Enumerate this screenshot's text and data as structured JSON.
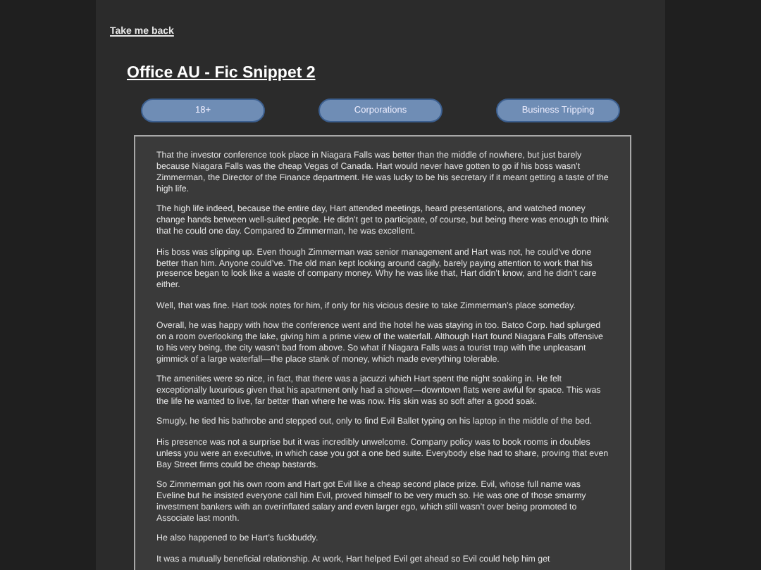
{
  "back_link": "Take me back",
  "title": "Office AU - Fic Snippet 2",
  "tags": [
    "18+",
    "Corporations",
    "Business Tripping"
  ],
  "paragraphs": [
    "That the investor conference took place in Niagara Falls was better than the middle of nowhere, but just barely because Niagara Falls was the cheap Vegas of Canada. Hart would never have gotten to go if his boss wasn’t Zimmerman, the Director of the Finance department. He was lucky to be his secretary if it meant getting a taste of the high life.",
    "The high life indeed, because the entire day, Hart attended meetings, heard presentations, and watched money change hands between well-suited people. He didn’t get to participate, of course, but being there was enough to think that he could one day. Compared to Zimmerman, he was excellent.",
    "His boss was slipping up. Even though Zimmerman was senior management and Hart was not, he could’ve done better than him. Anyone could’ve. The old man kept looking around cagily, barely paying attention to work that his presence began to look like a waste of company money. Why he was like that, Hart didn’t know, and he didn’t care either.",
    "Well, that was fine. Hart took notes for him, if only for his vicious desire to take Zimmerman’s place someday.",
    "Overall, he was happy with how the conference went and the hotel he was staying in too. Batco Corp. had splurged on a room overlooking the lake, giving him a prime view of the waterfall. Although Hart found Niagara Falls offensive to his very being, the city wasn’t bad from above. So what if Niagara Falls was a tourist trap with the unpleasant gimmick of a large waterfall—the place stank of money, which made everything tolerable.",
    "The amenities were so nice, in fact, that there was a jacuzzi which Hart spent the night soaking in. He felt exceptionally luxurious given that his apartment only had a shower—downtown flats were awful for space. This was the life he wanted to live, far better than where he was now. His skin was so soft after a good soak.",
    "Smugly, he tied his bathrobe and stepped out, only to find Evil Ballet typing on his laptop in the middle of the bed.",
    "His presence was not a surprise but it was incredibly unwelcome. Company policy was to book rooms in doubles unless you were an executive, in which case you got a one bed suite. Everybody else had to share, proving that even Bay Street firms could be cheap bastards.",
    "So Zimmerman got his own room and Hart got Evil like a cheap second place prize. Evil, whose full name was Eveline but he insisted everyone call him Evil, proved himself to be very much so. He was one of those smarmy investment bankers with an overinflated salary and even larger ego, which still wasn’t over being promoted to Associate last month.",
    "He also happened to be Hart’s fuckbuddy.",
    "It was a mutually beneficial relationship. At work, Hart helped Evil get ahead so Evil could help him get"
  ]
}
